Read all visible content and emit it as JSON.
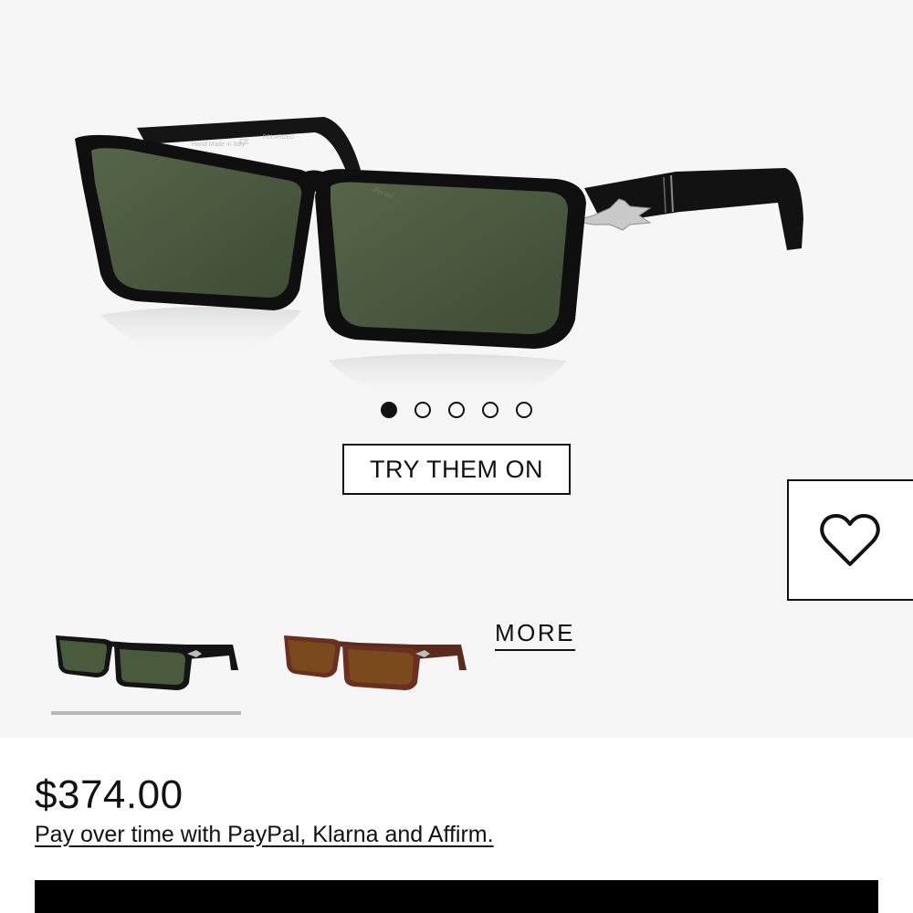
{
  "gallery": {
    "hero_image": {
      "alt": "Black rectangular sunglasses with green polarized lenses",
      "temple_text": [
        "Hand Made in Italy",
        "CE",
        "POLARIZED"
      ],
      "lens_logo": "Persol"
    },
    "carousel": {
      "total": 5,
      "active_index": 0
    },
    "try_on_label": "TRY THEM ON",
    "wishlist_icon": "heart-icon",
    "variants": [
      {
        "name": "black-green",
        "frame_color": "#111111",
        "lens_color": "#4a5a3c",
        "selected": true
      },
      {
        "name": "havana-brown",
        "frame_color": "#6a2f20",
        "lens_color": "#7a4a1c",
        "selected": false
      }
    ],
    "more_label": "MORE"
  },
  "product": {
    "price": "$374.00",
    "financing_text": "Pay over time with PayPal, Klarna and Affirm."
  },
  "colors": {
    "gallery_bg": "#f6f6f6",
    "text": "#111111",
    "cta": "#000000",
    "selected_underline": "#b9b9b9"
  }
}
